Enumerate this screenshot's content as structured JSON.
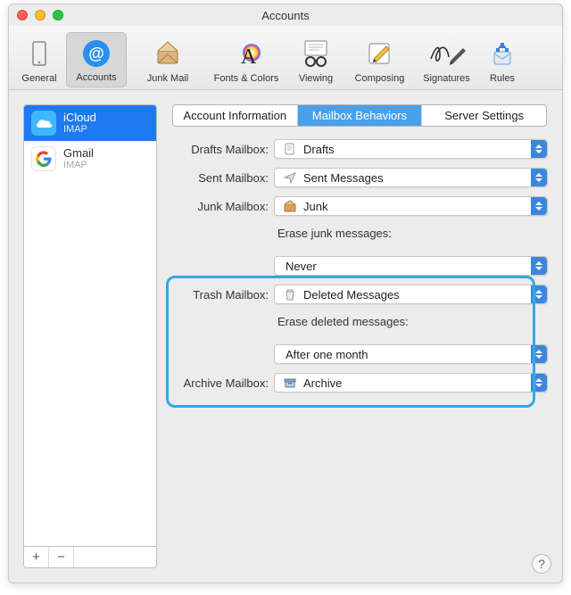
{
  "window": {
    "title": "Accounts"
  },
  "toolbar": [
    {
      "id": "general",
      "label": "General"
    },
    {
      "id": "accounts",
      "label": "Accounts"
    },
    {
      "id": "junk",
      "label": "Junk Mail"
    },
    {
      "id": "fonts",
      "label": "Fonts & Colors"
    },
    {
      "id": "viewing",
      "label": "Viewing"
    },
    {
      "id": "composing",
      "label": "Composing"
    },
    {
      "id": "signatures",
      "label": "Signatures"
    },
    {
      "id": "rules",
      "label": "Rules"
    }
  ],
  "toolbar_active": "accounts",
  "accounts": [
    {
      "name": "iCloud",
      "protocol": "IMAP",
      "icon": "cloud",
      "selected": true
    },
    {
      "name": "Gmail",
      "protocol": "IMAP",
      "icon": "google",
      "selected": false
    }
  ],
  "footer": {
    "add": "+",
    "remove": "−"
  },
  "tabs": [
    {
      "id": "info",
      "label": "Account Information"
    },
    {
      "id": "behaviors",
      "label": "Mailbox Behaviors"
    },
    {
      "id": "server",
      "label": "Server Settings"
    }
  ],
  "tabs_active": "behaviors",
  "form": {
    "drafts_label": "Drafts Mailbox:",
    "drafts_value": "Drafts",
    "sent_label": "Sent Mailbox:",
    "sent_value": "Sent Messages",
    "junk_label": "Junk Mailbox:",
    "junk_value": "Junk",
    "erase_junk_label": "Erase junk messages:",
    "erase_junk_value": "Never",
    "trash_label": "Trash Mailbox:",
    "trash_value": "Deleted Messages",
    "erase_deleted_label": "Erase deleted messages:",
    "erase_deleted_value": "After one month",
    "archive_label": "Archive Mailbox:",
    "archive_value": "Archive"
  },
  "help": "?"
}
